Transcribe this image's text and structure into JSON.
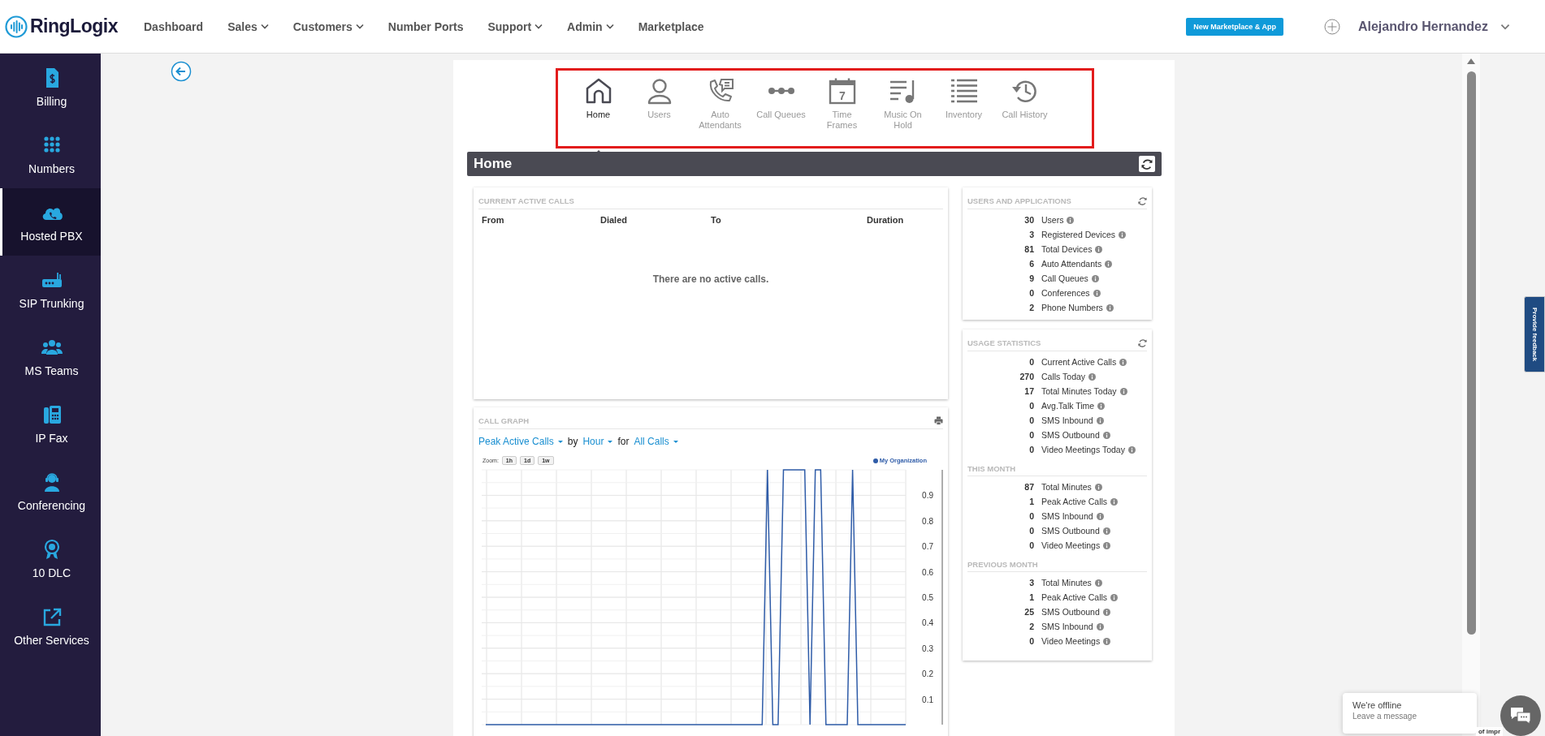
{
  "brand": {
    "name": "RingLogix"
  },
  "nav": [
    {
      "label": "Dashboard",
      "dropdown": false
    },
    {
      "label": "Sales",
      "dropdown": true
    },
    {
      "label": "Customers",
      "dropdown": true
    },
    {
      "label": "Number Ports",
      "dropdown": false
    },
    {
      "label": "Support",
      "dropdown": true
    },
    {
      "label": "Admin",
      "dropdown": true
    },
    {
      "label": "Marketplace",
      "dropdown": false
    }
  ],
  "header_button": "New Marketplace & App",
  "user": {
    "name": "Alejandro Hernandez"
  },
  "sidebar": {
    "items": [
      {
        "label": "Billing",
        "kind": "billing",
        "selected": false
      },
      {
        "label": "Numbers",
        "kind": "numbers",
        "selected": false
      },
      {
        "label": "Hosted PBX",
        "kind": "cloud",
        "selected": true
      },
      {
        "label": "SIP Trunking",
        "kind": "router",
        "selected": false
      },
      {
        "label": "MS Teams",
        "kind": "people",
        "selected": false
      },
      {
        "label": "IP Fax",
        "kind": "fax",
        "selected": false
      },
      {
        "label": "Conferencing",
        "kind": "headset",
        "selected": false
      },
      {
        "label": "10 DLC",
        "kind": "award",
        "selected": false
      },
      {
        "label": "Other Services",
        "kind": "external",
        "selected": false
      }
    ]
  },
  "toolbar": {
    "items": [
      {
        "label": "Home",
        "kind": "home",
        "selected": true
      },
      {
        "label": "Users",
        "kind": "user",
        "selected": false
      },
      {
        "label": "Auto\nAttendants",
        "kind": "phone-message",
        "selected": false
      },
      {
        "label": "Call Queues",
        "kind": "queue",
        "selected": false
      },
      {
        "label": "Time\nFrames",
        "kind": "calendar",
        "icon_text": "7",
        "selected": false
      },
      {
        "label": "Music On\nHold",
        "kind": "music",
        "selected": false
      },
      {
        "label": "Inventory",
        "kind": "list",
        "selected": false
      },
      {
        "label": "Call History",
        "kind": "history",
        "selected": false
      }
    ]
  },
  "page_title": "Home",
  "active_calls": {
    "title": "CURRENT ACTIVE CALLS",
    "columns": [
      "From",
      "Dialed",
      "To",
      "Duration"
    ],
    "empty_message": "There are no active calls."
  },
  "call_graph": {
    "title": "CALL GRAPH",
    "selectors": [
      {
        "kind": "dropdown",
        "label": "Peak Active Calls"
      },
      {
        "kind": "text",
        "label": "by"
      },
      {
        "kind": "dropdown",
        "label": "Hour"
      },
      {
        "kind": "text",
        "label": "for"
      },
      {
        "kind": "dropdown",
        "label": "All Calls"
      }
    ],
    "zoom_label": "Zoom:",
    "zoom_buttons": [
      "1h",
      "1d",
      "1w"
    ],
    "chart_data": {
      "type": "line",
      "grid": true,
      "ylim": [
        0,
        1
      ],
      "yticks": [
        0.1,
        0.2,
        0.3,
        0.4,
        0.5,
        0.6,
        0.7,
        0.8,
        0.9
      ],
      "series": [
        {
          "name": "My Organization",
          "color": "#2f5ca8",
          "values": [
            0,
            0,
            0,
            0,
            0,
            0,
            0,
            0,
            0,
            0,
            0,
            0,
            0,
            0,
            0,
            0,
            0,
            0,
            0,
            0,
            0,
            0,
            0,
            0,
            0,
            0,
            0,
            0,
            0,
            0,
            0,
            0,
            0,
            0,
            0,
            0,
            0,
            0,
            0,
            0,
            0,
            0,
            0,
            0,
            0,
            0,
            0,
            0,
            0,
            0,
            0,
            0,
            0,
            1,
            0,
            0,
            1,
            1,
            1,
            1,
            1,
            0,
            1,
            1,
            0,
            0,
            0,
            0,
            0,
            1,
            0,
            0,
            0,
            0,
            0,
            0,
            0,
            0,
            0,
            0
          ]
        }
      ]
    }
  },
  "users_and_applications": {
    "title": "USERS AND APPLICATIONS",
    "stats": [
      {
        "count": "30",
        "name": "Users"
      },
      {
        "count": "3",
        "name": "Registered Devices"
      },
      {
        "count": "81",
        "name": "Total Devices"
      },
      {
        "count": "6",
        "name": "Auto Attendants"
      },
      {
        "count": "9",
        "name": "Call Queues"
      },
      {
        "count": "0",
        "name": "Conferences"
      },
      {
        "count": "2",
        "name": "Phone Numbers"
      }
    ]
  },
  "usage_statistics": {
    "title": "USAGE STATISTICS",
    "sections": [
      {
        "stats": [
          {
            "count": "0",
            "name": "Current Active Calls"
          },
          {
            "count": "270",
            "name": "Calls Today"
          },
          {
            "count": "17",
            "name": "Total Minutes Today"
          },
          {
            "count": "0",
            "name": "Avg.Talk Time"
          },
          {
            "count": "0",
            "name": "SMS Inbound"
          },
          {
            "count": "0",
            "name": "SMS Outbound"
          },
          {
            "count": "0",
            "name": "Video Meetings Today"
          }
        ]
      },
      {
        "title": "THIS MONTH",
        "stats": [
          {
            "count": "87",
            "name": "Total Minutes"
          },
          {
            "count": "1",
            "name": "Peak Active Calls"
          },
          {
            "count": "0",
            "name": "SMS Inbound"
          },
          {
            "count": "0",
            "name": "SMS Outbound"
          },
          {
            "count": "0",
            "name": "Video Meetings"
          }
        ]
      },
      {
        "title": "PREVIOUS MONTH",
        "stats": [
          {
            "count": "3",
            "name": "Total Minutes"
          },
          {
            "count": "1",
            "name": "Peak Active Calls"
          },
          {
            "count": "25",
            "name": "SMS Outbound"
          },
          {
            "count": "2",
            "name": "SMS Inbound"
          },
          {
            "count": "0",
            "name": "Video Meetings"
          }
        ]
      }
    ]
  },
  "feedback_tab": "Provide feedback",
  "chat": {
    "status": "We're offline",
    "prompt": "Leave a message"
  },
  "footer_fragment": "of impr"
}
